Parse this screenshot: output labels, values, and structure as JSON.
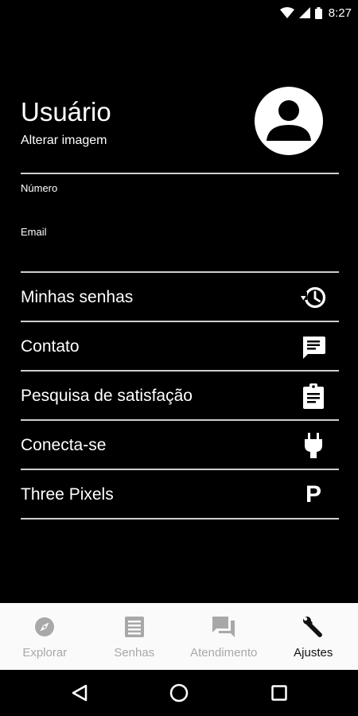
{
  "status_bar": {
    "time": "8:27"
  },
  "profile": {
    "name": "Usuário",
    "change_image": "Alterar imagem"
  },
  "fields": {
    "number_label": "Número",
    "email_label": "Email"
  },
  "menu": [
    {
      "label": "Minhas senhas",
      "icon": "history-icon"
    },
    {
      "label": "Contato",
      "icon": "chat-icon"
    },
    {
      "label": "Pesquisa de satisfação",
      "icon": "clipboard-icon"
    },
    {
      "label": "Conecta-se",
      "icon": "plug-icon"
    },
    {
      "label": "Three Pixels",
      "icon": "parking-icon",
      "icon_text": "P"
    }
  ],
  "bottom_nav": {
    "tabs": [
      {
        "label": "Explorar",
        "icon": "compass-icon"
      },
      {
        "label": "Senhas",
        "icon": "list-icon"
      },
      {
        "label": "Atendimento",
        "icon": "forum-icon"
      },
      {
        "label": "Ajustes",
        "icon": "wrench-icon",
        "active": true
      }
    ]
  },
  "colors": {
    "background": "#000000",
    "text": "#ffffff",
    "divider": "#cfcfcf",
    "nav_background": "#fafafa",
    "nav_inactive": "#a8a8a8",
    "nav_active": "#111111"
  }
}
